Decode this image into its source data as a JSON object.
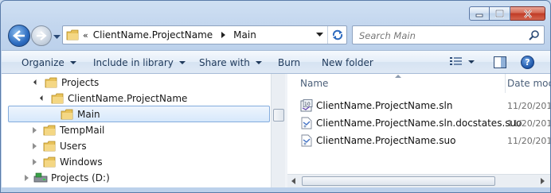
{
  "window": {
    "caption_buttons": [
      "minimize",
      "maximize",
      "close"
    ]
  },
  "address": {
    "overflow": "«",
    "crumbs": [
      "ClientName.ProjectName",
      "Main"
    ]
  },
  "search": {
    "placeholder": "Search Main"
  },
  "toolbar": {
    "organize": "Organize",
    "include_in_library": "Include in library",
    "share_with": "Share with",
    "burn": "Burn",
    "new_folder": "New folder"
  },
  "tree": [
    {
      "label": "Projects",
      "expanded": true
    },
    {
      "label": "ClientName.ProjectName",
      "expanded": true
    },
    {
      "label": "Main",
      "selected": true
    },
    {
      "label": "TempMail"
    },
    {
      "label": "Users"
    },
    {
      "label": "Windows"
    },
    {
      "label": "Projects (D:)"
    }
  ],
  "columns": {
    "name": "Name",
    "date": "Date moc"
  },
  "files": [
    {
      "name": "ClientName.ProjectName.sln",
      "date": "11/20/201",
      "icon": "solution-file-icon"
    },
    {
      "name": "ClientName.ProjectName.sln.docstates.suo",
      "date": "11/20/201",
      "icon": "suo-file-icon"
    },
    {
      "name": "ClientName.ProjectName.suo",
      "date": "11/20/201",
      "icon": "suo-file-icon"
    }
  ],
  "colors": {
    "accent": "#1e395b",
    "selection": "#d6e8fb",
    "frame": "#c3d6ee"
  }
}
